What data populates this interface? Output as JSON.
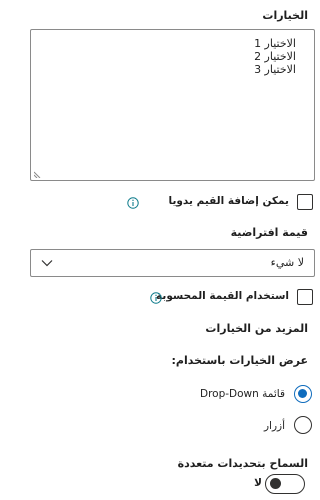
{
  "choices": {
    "label": "الخيارات",
    "lines": [
      "الاختيار 1",
      "الاختيار 2",
      "الاختيار 3"
    ]
  },
  "manual_values": {
    "label": "يمكن إضافة القيم يدويا",
    "checked": false
  },
  "default_value": {
    "label": "قيمة افتراضية",
    "selected": "لا شيء"
  },
  "calculated_value": {
    "label": "استخدام القيمة المحسوبة",
    "checked": false
  },
  "more_options": {
    "heading": "المزيد من الخيارات",
    "display_label": "عرض الخيارات باستخدام:",
    "options": [
      "قائمة Drop-Down",
      "أزرار"
    ],
    "selected_index": 0
  },
  "multi_select": {
    "label": "السماح بتحديدات متعددة",
    "state_label": "لا",
    "on": false
  },
  "colors": {
    "accent": "#0f6cbd",
    "info_icon": "#0f7c8c",
    "border": "#8a8a8a"
  }
}
